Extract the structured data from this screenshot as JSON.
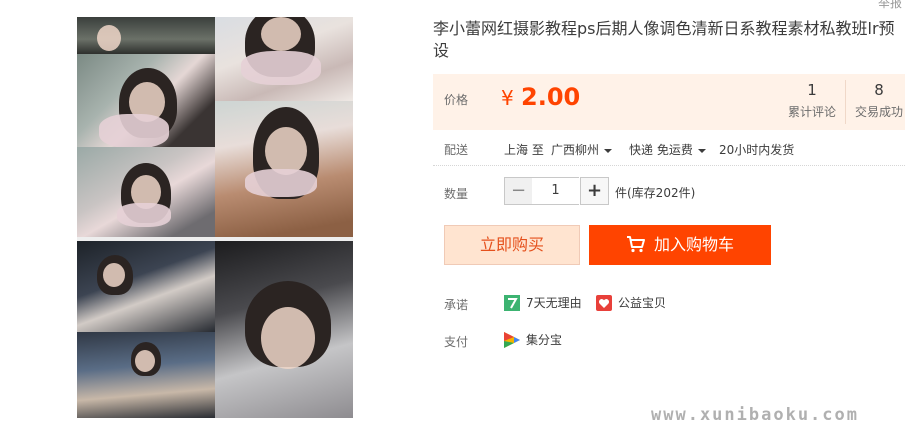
{
  "top_link": "举报",
  "product": {
    "title": "李小蕾网红摄影教程ps后期人像调色清新日系教程素材私教班lr预设"
  },
  "price": {
    "label": "价格",
    "currency": "¥",
    "value": "2.00",
    "color": "#ff4400"
  },
  "stats": {
    "reviews_count": "1",
    "reviews_label": "累计评论",
    "deals_count": "8",
    "deals_label": "交易成功"
  },
  "shipping": {
    "label": "配送",
    "from": "上海 至",
    "to": "广西柳州",
    "method": "快递 免运费",
    "dispatch": "20小时内发货"
  },
  "quantity": {
    "label": "数量",
    "minus": "−",
    "value": "1",
    "plus": "+",
    "stock": "件(库存202件)"
  },
  "actions": {
    "buy_now": "立即购买",
    "add_to_cart": "加入购物车"
  },
  "promise": {
    "label": "承诺",
    "items": [
      {
        "icon": "seven-day-return-icon",
        "text": "7天无理由"
      },
      {
        "icon": "charity-gift-icon",
        "text": "公益宝贝"
      }
    ]
  },
  "payment": {
    "label": "支付",
    "items": [
      {
        "icon": "jifenbao-icon",
        "text": "集分宝"
      }
    ]
  },
  "watermark": "www.xunibaoku.com"
}
